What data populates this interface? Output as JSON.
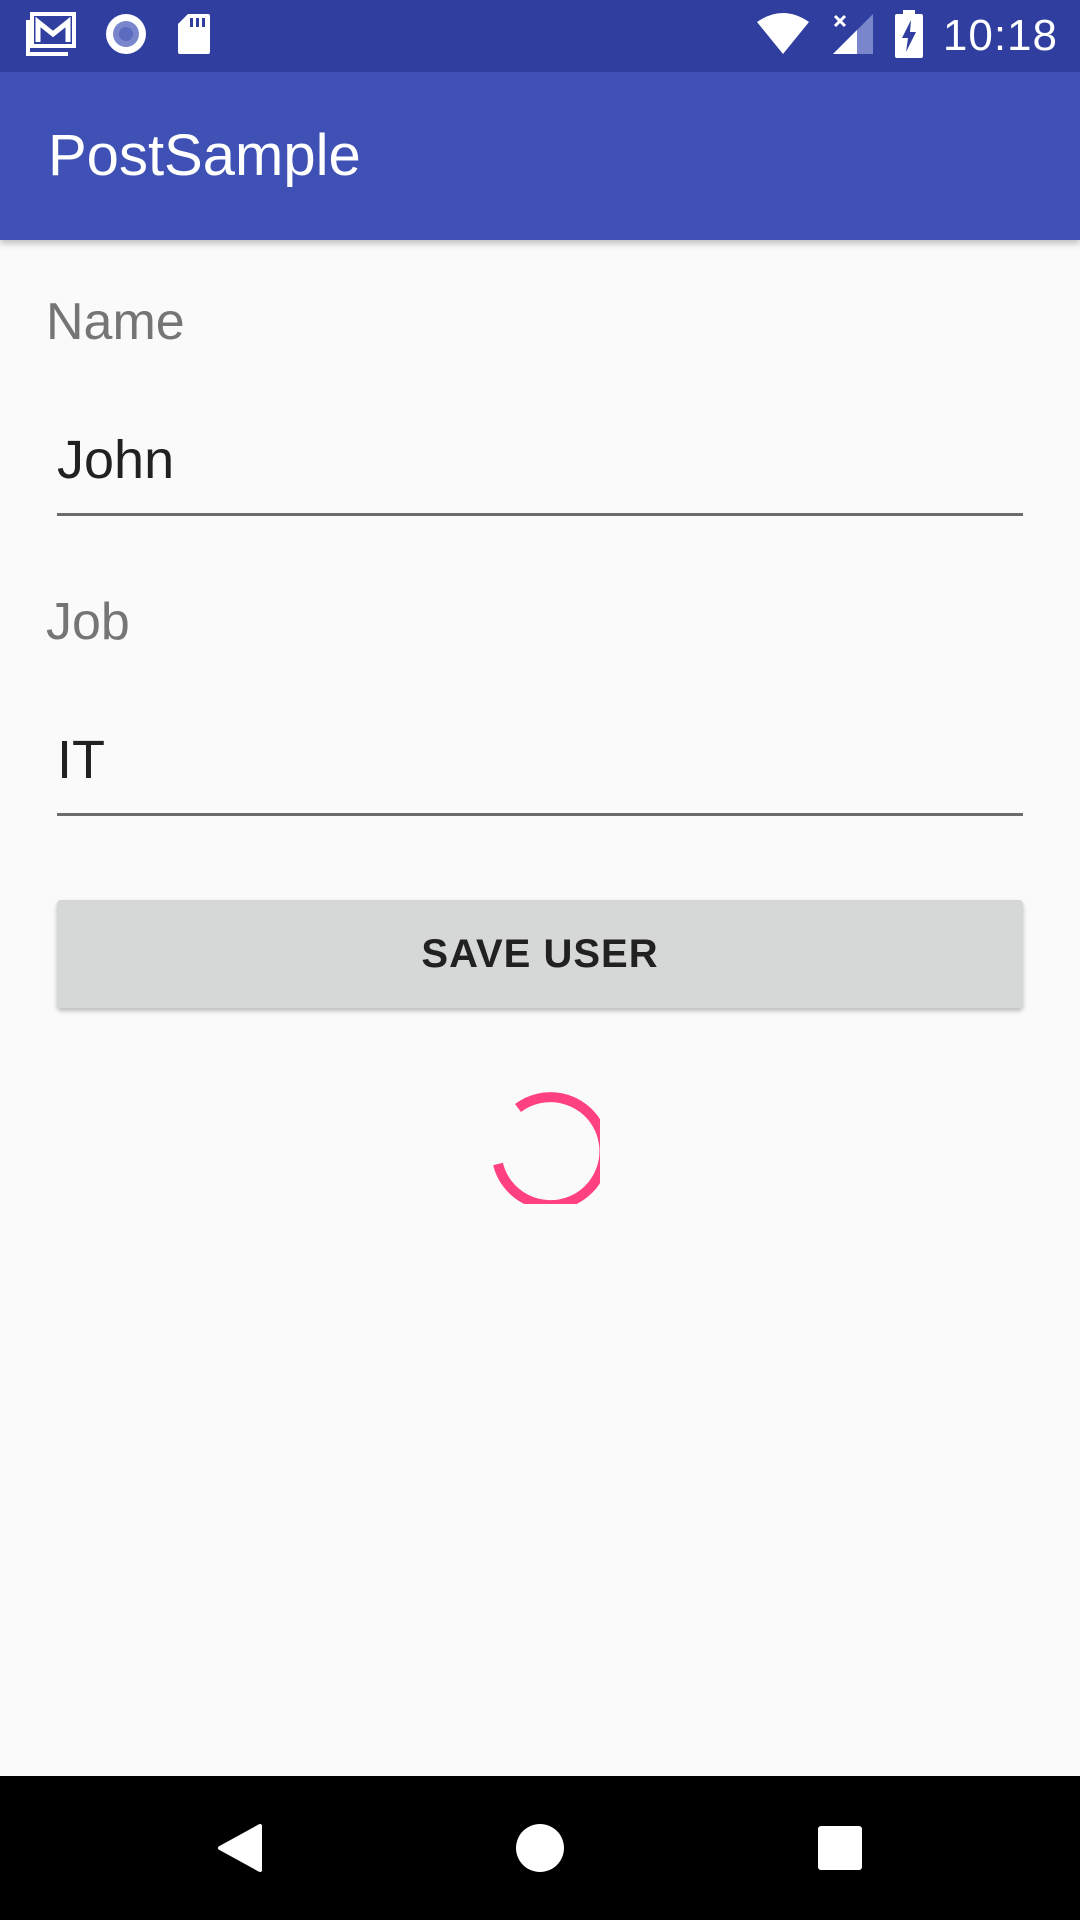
{
  "status_bar": {
    "time": "10:18",
    "left_icons": [
      "gmail-icon",
      "record-icon",
      "sd-card-icon"
    ],
    "right_icons": [
      "wifi-icon",
      "signal-icon",
      "battery-charging-icon"
    ]
  },
  "app_bar": {
    "title": "PostSample",
    "color": "#3f51b5"
  },
  "form": {
    "name_label": "Name",
    "name_value": "John",
    "job_label": "Job",
    "job_value": "IT",
    "save_button_label": "SAVE USER"
  },
  "progress": {
    "state": "loading",
    "accent_color": "#ff4081"
  },
  "nav_bar": {
    "buttons": [
      "back-icon",
      "home-icon",
      "recents-icon"
    ]
  }
}
